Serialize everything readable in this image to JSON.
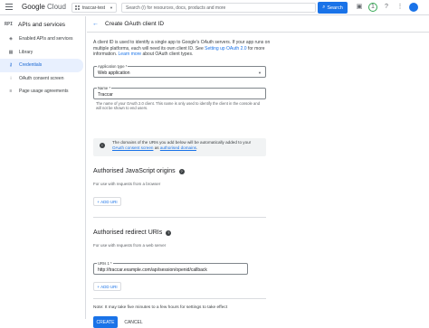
{
  "topbar": {
    "logo_google": "Google",
    "logo_cloud": "Cloud",
    "project_name": "traccar-test",
    "search_placeholder": "Search (/) for resources, docs, products and more",
    "search_button": "Search",
    "notification_count": "1"
  },
  "sidebar": {
    "badge": "RPI",
    "title": "APIs and services",
    "items": [
      {
        "label": "Enabled APIs and services",
        "icon": "grid-icon"
      },
      {
        "label": "Library",
        "icon": "library-icon"
      },
      {
        "label": "Credentials",
        "icon": "key-icon",
        "active": true
      },
      {
        "label": "OAuth consent screen",
        "icon": "consent-icon"
      },
      {
        "label": "Page usage agreements",
        "icon": "settings-icon"
      }
    ]
  },
  "page": {
    "title": "Create OAuth client ID"
  },
  "intro": {
    "text1": "A client ID is used to identify a single app to Google's OAuth servers. If your app runs on multiple platforms, each will need its own client ID. See ",
    "link1": "Setting up OAuth 2.0",
    "text2": " for more information. ",
    "link2": "Learn more",
    "text3": " about OAuth client types."
  },
  "form": {
    "app_type_label": "Application type *",
    "app_type_value": "Web application",
    "name_label": "Name *",
    "name_value": "Traccar",
    "name_helper": "The name of your OAuth 2.0 client. This name is only used to identify the client in the console and will not be shown to end users."
  },
  "info_box": {
    "text1": "The domains of the URIs you add below will be automatically added to your ",
    "link1": "OAuth consent screen",
    "text2": " as ",
    "link2": "authorised domains",
    "text3": "."
  },
  "js_origins": {
    "title": "Authorised JavaScript origins",
    "subtitle": "For use with requests from a browser",
    "add_label": "ADD URI"
  },
  "redirect_uris": {
    "title": "Authorised redirect URIs",
    "subtitle": "For use with requests from a web server",
    "uri_label": "URIs 1 *",
    "uri_value": "http://traccar.example.com/api/session/openid/callback",
    "add_label": "ADD URI"
  },
  "footer": {
    "note": "Note: It may take five minutes to a few hours for settings to take effect",
    "create": "CREATE",
    "cancel": "CANCEL"
  },
  "colors": {
    "accent": "#1a73e8",
    "active_bg": "#e8f0fe"
  }
}
